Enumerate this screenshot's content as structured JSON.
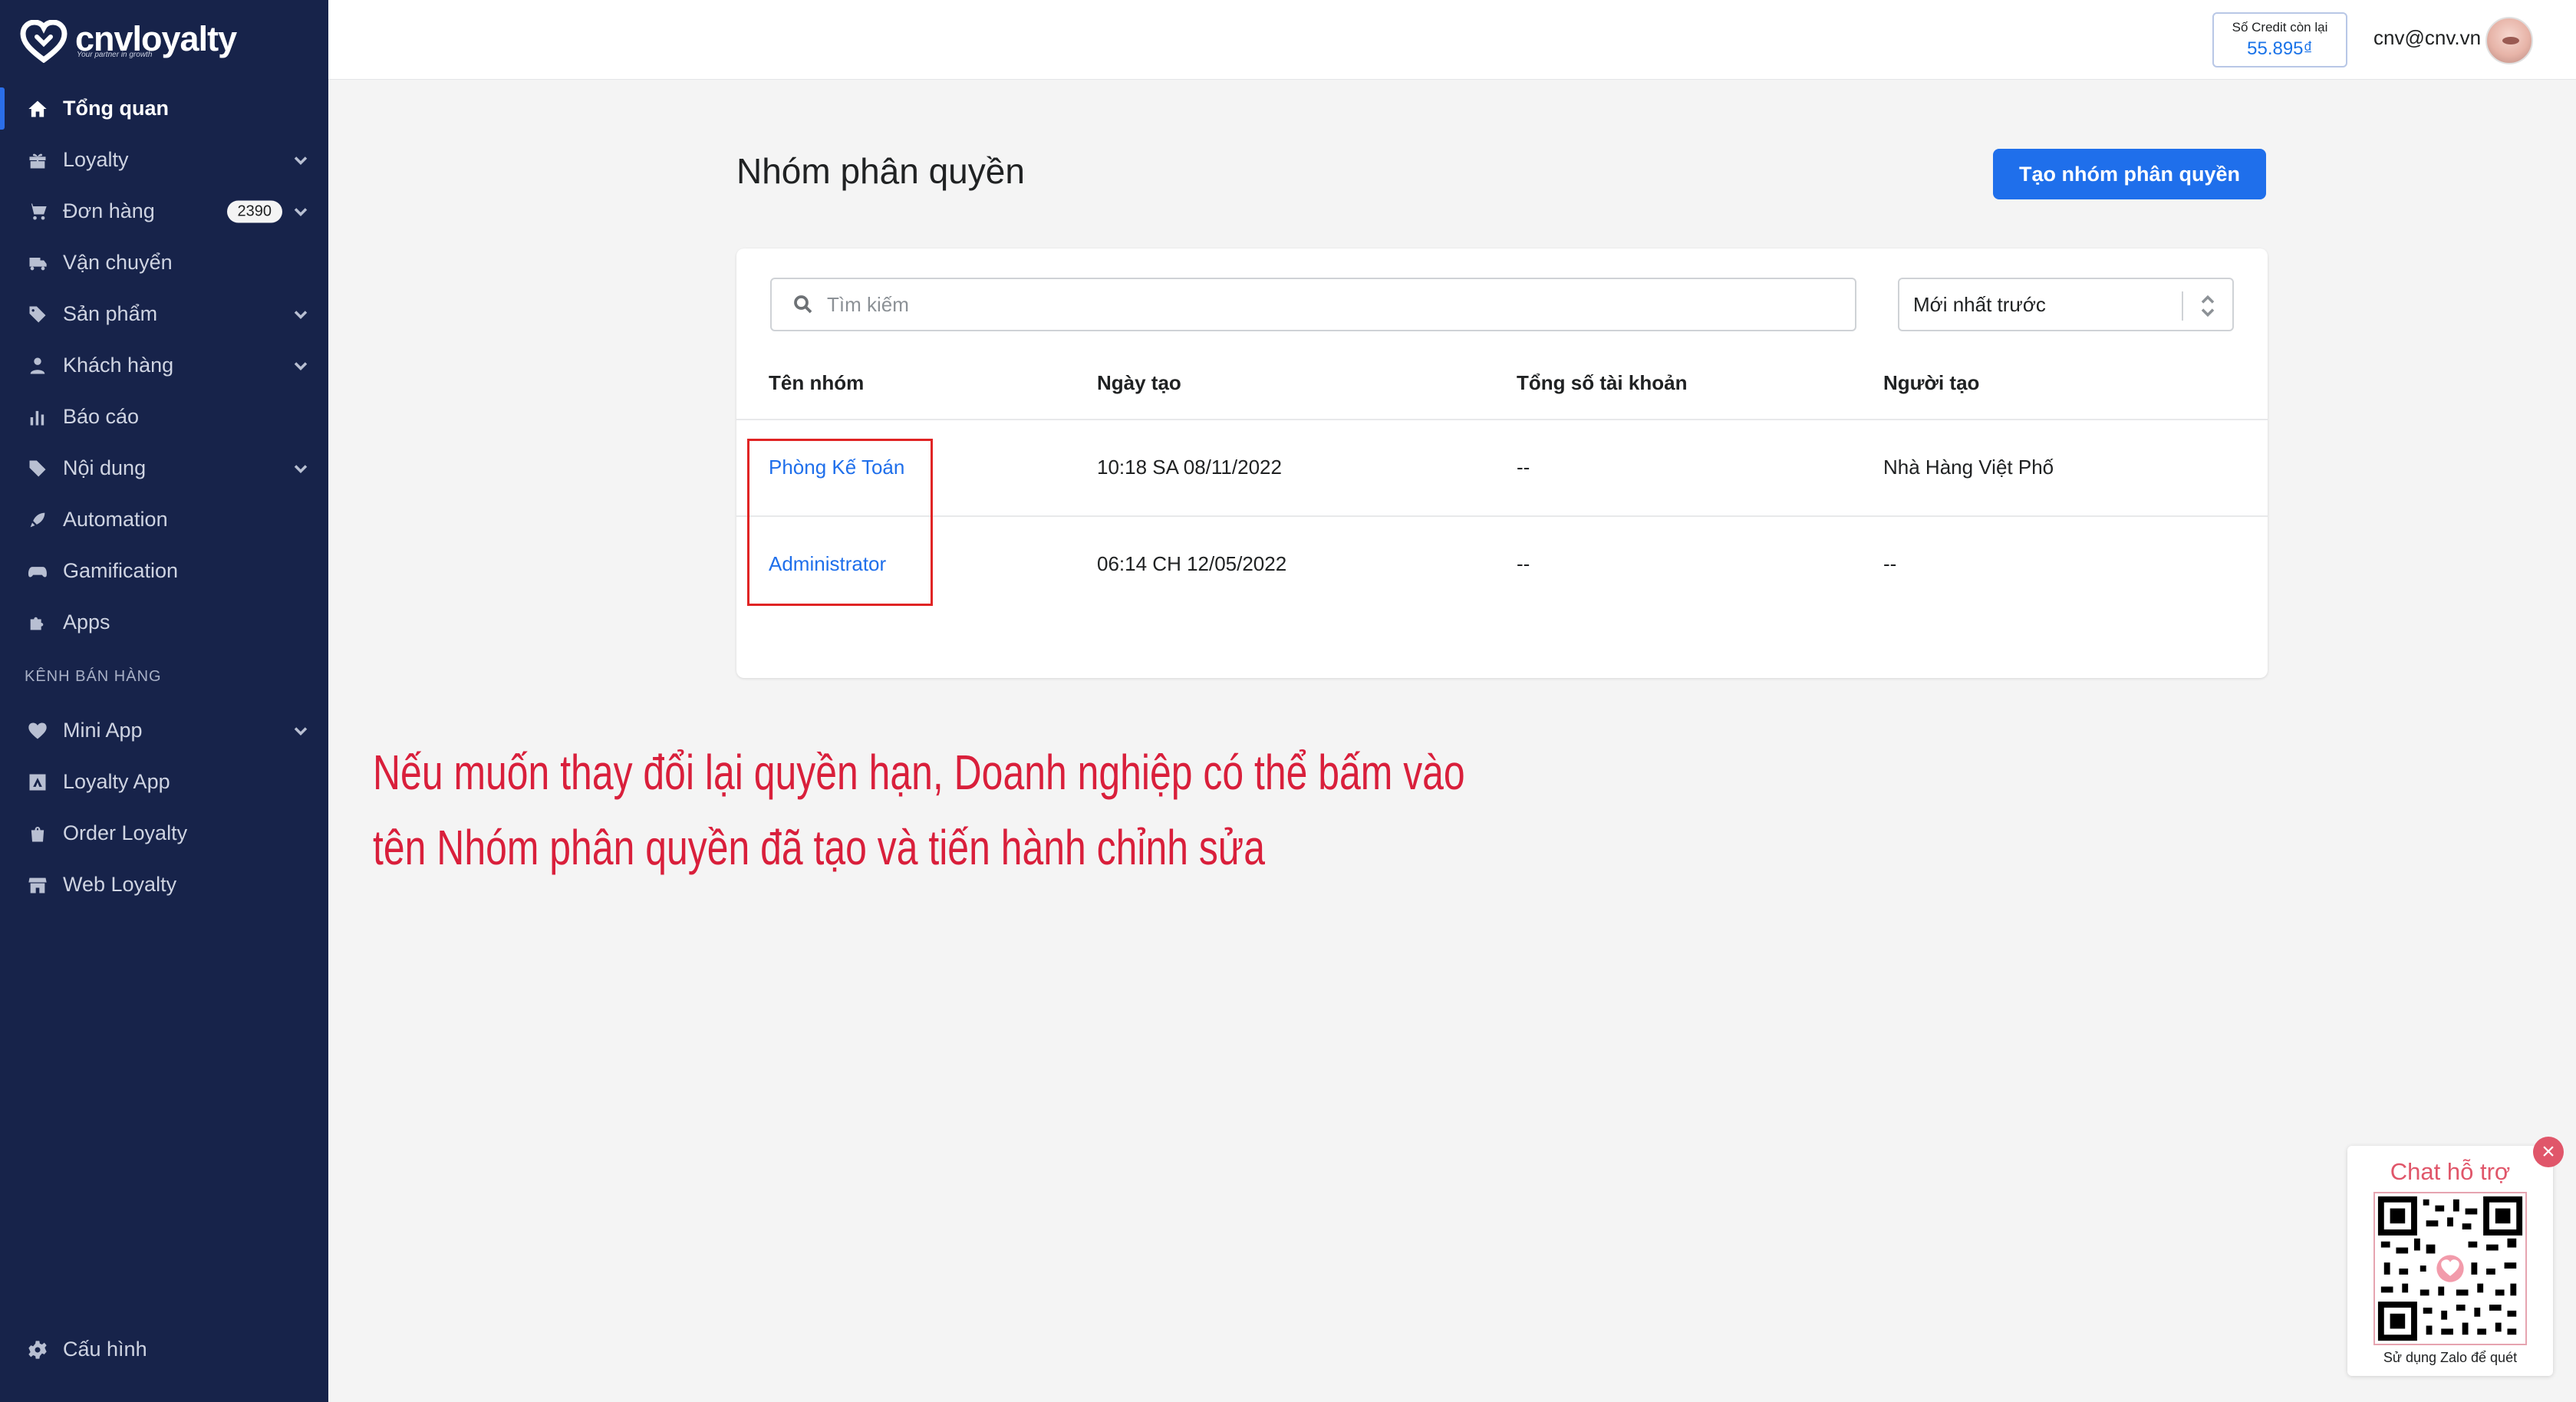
{
  "brand": {
    "name": "cnvloyalty",
    "tagline": "Your partner in growth"
  },
  "sidebar": {
    "items": [
      {
        "label": "Tổng quan",
        "icon": "home-icon"
      },
      {
        "label": "Loyalty",
        "icon": "gift-icon"
      },
      {
        "label": "Đơn hàng",
        "icon": "cart-icon",
        "badge": "2390"
      },
      {
        "label": "Vận chuyển",
        "icon": "truck-icon"
      },
      {
        "label": "Sản phẩm",
        "icon": "tag-icon"
      },
      {
        "label": "Khách hàng",
        "icon": "person-icon"
      },
      {
        "label": "Báo cáo",
        "icon": "bar-chart-icon"
      },
      {
        "label": "Nội dung",
        "icon": "content-tag-icon"
      },
      {
        "label": "Automation",
        "icon": "rocket-icon"
      },
      {
        "label": "Gamification",
        "icon": "gamepad-icon"
      },
      {
        "label": "Apps",
        "icon": "puzzle-icon"
      }
    ],
    "section_label": "KÊNH BÁN HÀNG",
    "channels": [
      {
        "label": "Mini App",
        "icon": "heart-icon"
      },
      {
        "label": "Loyalty App",
        "icon": "app-icon"
      },
      {
        "label": "Order Loyalty",
        "icon": "bag-icon"
      },
      {
        "label": "Web Loyalty",
        "icon": "store-icon"
      }
    ],
    "settings_label": "Cấu hình"
  },
  "topbar": {
    "credit_label": "Số Credit còn lại",
    "credit_value": "55.895₫",
    "user_email": "cnv@cnv.vn"
  },
  "page": {
    "title": "Nhóm phân quyền",
    "create_button": "Tạo nhóm phân quyền",
    "search_placeholder": "Tìm kiếm",
    "sort_value": "Mới nhất trước",
    "columns": [
      "Tên nhóm",
      "Ngày tạo",
      "Tổng số tài khoản",
      "Người tạo"
    ],
    "rows": [
      {
        "name": "Phòng Kế Toán",
        "created": "10:18 SA  08/11/2022",
        "accounts": "--",
        "creator": "Nhà Hàng Việt Phố"
      },
      {
        "name": "Administrator",
        "created": "06:14 CH  12/05/2022",
        "accounts": "--",
        "creator": "--"
      }
    ]
  },
  "annotation": {
    "line1": "Nếu muốn thay đổi lại quyền hạn, Doanh nghiệp có thể bấm vào",
    "line2": "tên Nhóm phân quyền đã tạo và tiến hành chỉnh sửa",
    "color": "#d91f3b"
  },
  "chat": {
    "title": "Chat hỗ trợ",
    "footer": "Sử dụng Zalo để quét"
  },
  "colors": {
    "sidebar": "#17234a",
    "primary": "#1f6feb",
    "background": "#f4f4f4"
  }
}
